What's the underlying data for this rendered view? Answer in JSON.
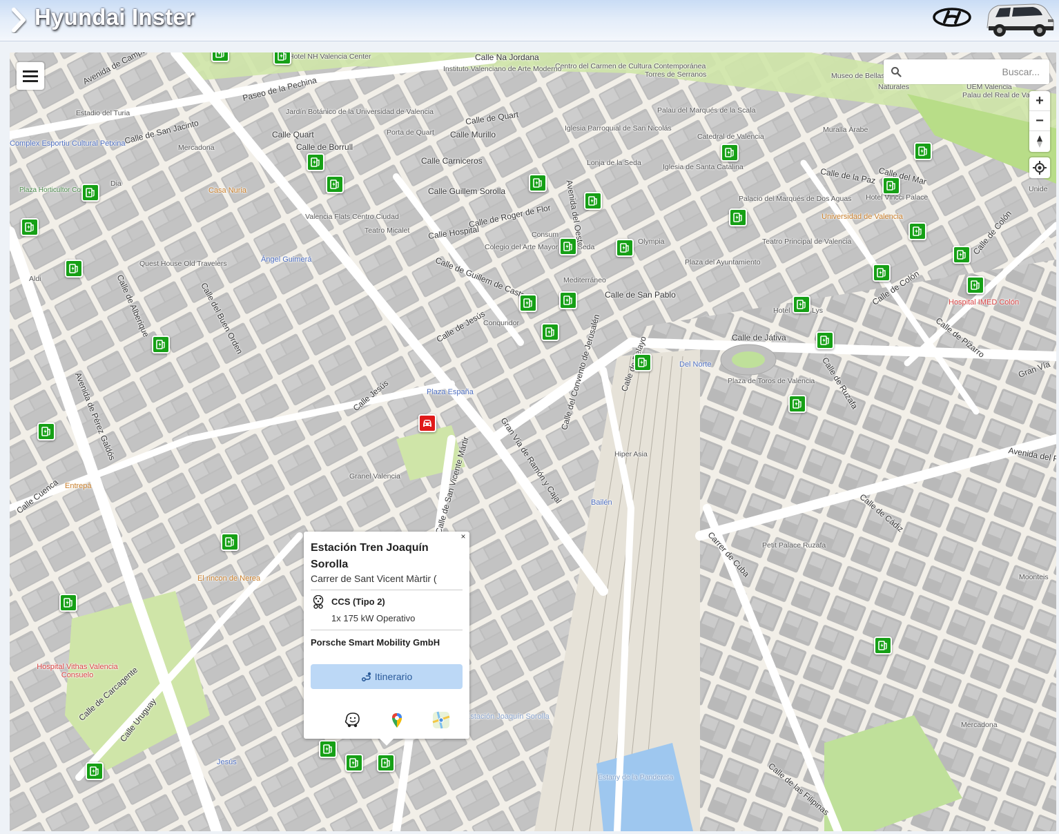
{
  "header": {
    "title": "Hyundai Inster"
  },
  "search": {
    "placeholder": "Buscar..."
  },
  "controls": {
    "zoom_in": "+",
    "zoom_out": "−"
  },
  "popup": {
    "close": "×",
    "title": "Estación Tren Joaquín Sorolla",
    "address": "Carrer de Sant Vicent Màrtir (",
    "connector_type": "CCS (Tipo 2)",
    "connector_detail": "1x 175 kW Operativo",
    "operator": "Porsche Smart Mobility GmbH",
    "route_label": "Itinerario",
    "apps": [
      "waze-icon",
      "google-maps-icon",
      "apple-maps-icon"
    ]
  },
  "map_labels": {
    "streets": [
      "Avenida de Campanar",
      "Paseo de la Pechina",
      "Calle Quart",
      "Calle de Borrull",
      "Calle de San Jacinto",
      "Calle de Quart",
      "Calle Murillo",
      "Calle Carniceros",
      "Calle Guillem Sorolla",
      "Calle de Roger de Flor",
      "Calle Hospital",
      "Calle de Guillem de Castro",
      "Calle de Jesús",
      "Calle Jesús",
      "Avenida de Pérez Galdós",
      "Calle de Alberique",
      "Calle del Buen Orden",
      "Calle Cuenca",
      "Calle de Carcagente",
      "Calle Uruguay",
      "Calle de San Vicente Mártir",
      "Gran Vía de Ramón y Cajal",
      "Calle del Convento de Jerusalén",
      "Calle de Pelayo",
      "Calle de San Pablo",
      "Calle de Játiva",
      "Calle de Colón",
      "Calle de Pizarro",
      "Calle de Ruzafa",
      "Calle de Cádiz",
      "Carrer de Cuba",
      "Calle de la Paz",
      "Avenida del Oeste",
      "Calle de las Filipinas",
      "Gran Vía",
      "Avenida del Puerto",
      "Calle de Colón",
      "Calle del Mar",
      "Calle Na Jordana"
    ],
    "pois": [
      "Jardín Botánico de la Universidad de Valencia",
      "Estadio del Turia",
      "Mercadona",
      "Plaza Horticultor Corset",
      "Casa Nuria",
      "Dia",
      "Quest House Old Travelers",
      "Ángel Guimerá",
      "Valencia Flats Centro Ciudad",
      "Teatro Micalet",
      "Colegio del Arte Mayor de la Seda",
      "Consum",
      "Mediterráneo",
      "Olympia",
      "Plaza del Ayuntamiento",
      "Teatro Principal de Valencia",
      "Universidad de Valencia",
      "Hotel Vincci Palace",
      "Hospital IMED Colón",
      "Lys",
      "Hotel",
      "Plaza de Toros de Valencia",
      "Del Norte",
      "Conquridor",
      "Plaza España",
      "Granel Valencia",
      "Entrepà",
      "El rincon de Nerea",
      "Hospital Vithas Valencia Consuelo",
      "Jesús",
      "Hiper Asia",
      "Bailén",
      "Petit Palace Ruzafa",
      "Moonteis",
      "Aldi",
      "Mercadona",
      "Estany de la Pandereta",
      "Lonja de la Seda",
      "Iglesia de Santa Catalina",
      "Palau del Marqués de la Scala",
      "Iglesia Parroquial de San Nicolás",
      "Catedral de Valencia",
      "Muralla Árabe",
      "Torres de Serranos",
      "Museo de Bellas Artes de Valencia",
      "Palau del Real de València",
      "UEM Valencia",
      "Centro del Carmen de Cultura Contemporánea",
      "Instituto Valenciano de Arte Moderno",
      "Hotel NH Valencia Center",
      "Porta de Quart",
      "Palacio del Marqués de Dos Aguas",
      "Complex Esportiu Cultural Petxina",
      "Estación Joaquín Sorolla",
      "Unide",
      "Naturales"
    ]
  },
  "colors": {
    "marker_green": "#16a016",
    "marker_red": "#e01a1a",
    "route_button": "#bcd8f6",
    "route_text": "#2a5a99"
  }
}
